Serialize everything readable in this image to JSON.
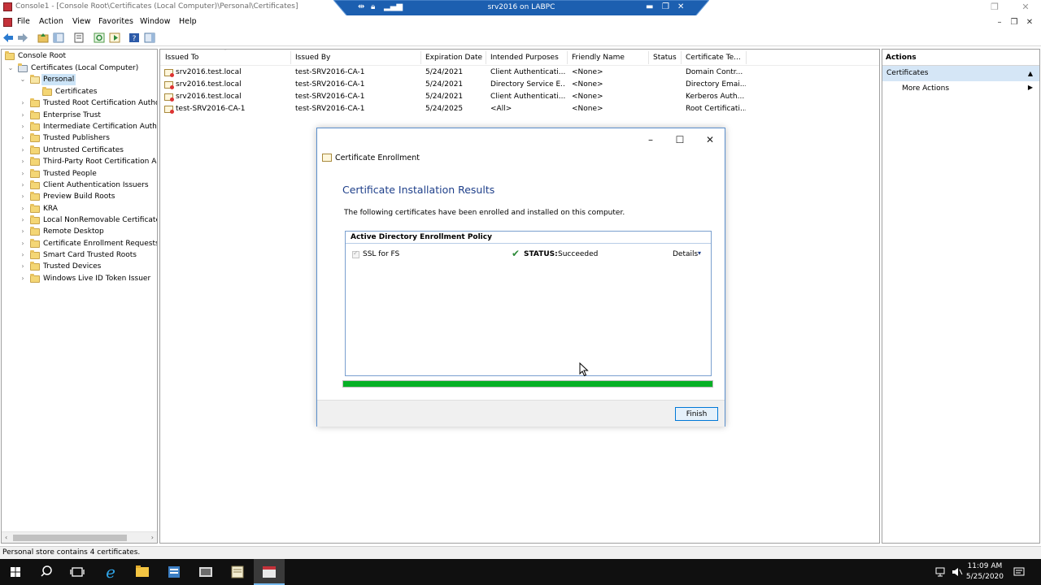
{
  "window": {
    "title": "Console1 - [Console Root\\Certificates (Local Computer)\\Personal\\Certificates]"
  },
  "rdp": {
    "host": "srv2016 on LABPC"
  },
  "menu": {
    "items": [
      "File",
      "Action",
      "View",
      "Favorites",
      "Window",
      "Help"
    ]
  },
  "tree": {
    "root": "Console Root",
    "store": "Certificates (Local Computer)",
    "personal": "Personal",
    "certificates": "Certificates",
    "items": [
      "Trusted Root Certification Author",
      "Enterprise Trust",
      "Intermediate Certification Author",
      "Trusted Publishers",
      "Untrusted Certificates",
      "Third-Party Root Certification Aut",
      "Trusted People",
      "Client Authentication Issuers",
      "Preview Build Roots",
      "KRA",
      "Local NonRemovable Certificates",
      "Remote Desktop",
      "Certificate Enrollment Requests",
      "Smart Card Trusted Roots",
      "Trusted Devices",
      "Windows Live ID Token Issuer"
    ]
  },
  "list": {
    "columns": [
      "Issued To",
      "Issued By",
      "Expiration Date",
      "Intended Purposes",
      "Friendly Name",
      "Status",
      "Certificate Te..."
    ],
    "rows": [
      [
        "srv2016.test.local",
        "test-SRV2016-CA-1",
        "5/24/2021",
        "Client Authenticati...",
        "<None>",
        "",
        "Domain Contr..."
      ],
      [
        "srv2016.test.local",
        "test-SRV2016-CA-1",
        "5/24/2021",
        "Directory Service E...",
        "<None>",
        "",
        "Directory Emai..."
      ],
      [
        "srv2016.test.local",
        "test-SRV2016-CA-1",
        "5/24/2021",
        "Client Authenticati...",
        "<None>",
        "",
        "Kerberos Auth..."
      ],
      [
        "test-SRV2016-CA-1",
        "test-SRV2016-CA-1",
        "5/24/2025",
        "<All>",
        "<None>",
        "",
        "Root Certificati..."
      ]
    ]
  },
  "actions": {
    "header": "Actions",
    "section": "Certificates",
    "more": "More Actions"
  },
  "status": {
    "text": "Personal store contains 4 certificates."
  },
  "dialog": {
    "title": "Certificate Enrollment",
    "heading": "Certificate Installation Results",
    "description": "The following certificates have been enrolled and installed on this computer.",
    "policy": "Active Directory Enrollment Policy",
    "cert_name": "SSL for FS",
    "status_label": "STATUS:",
    "status_value": "Succeeded",
    "details": "Details",
    "progress": 1.0,
    "finish": "Finish"
  },
  "taskbar": {
    "time": "11:09 AM",
    "date": "5/25/2020"
  },
  "colors": {
    "accent": "#0078d7",
    "success": "#06b025",
    "heading": "#1e3f8a",
    "rdp_bar": "#1c5fb0"
  }
}
